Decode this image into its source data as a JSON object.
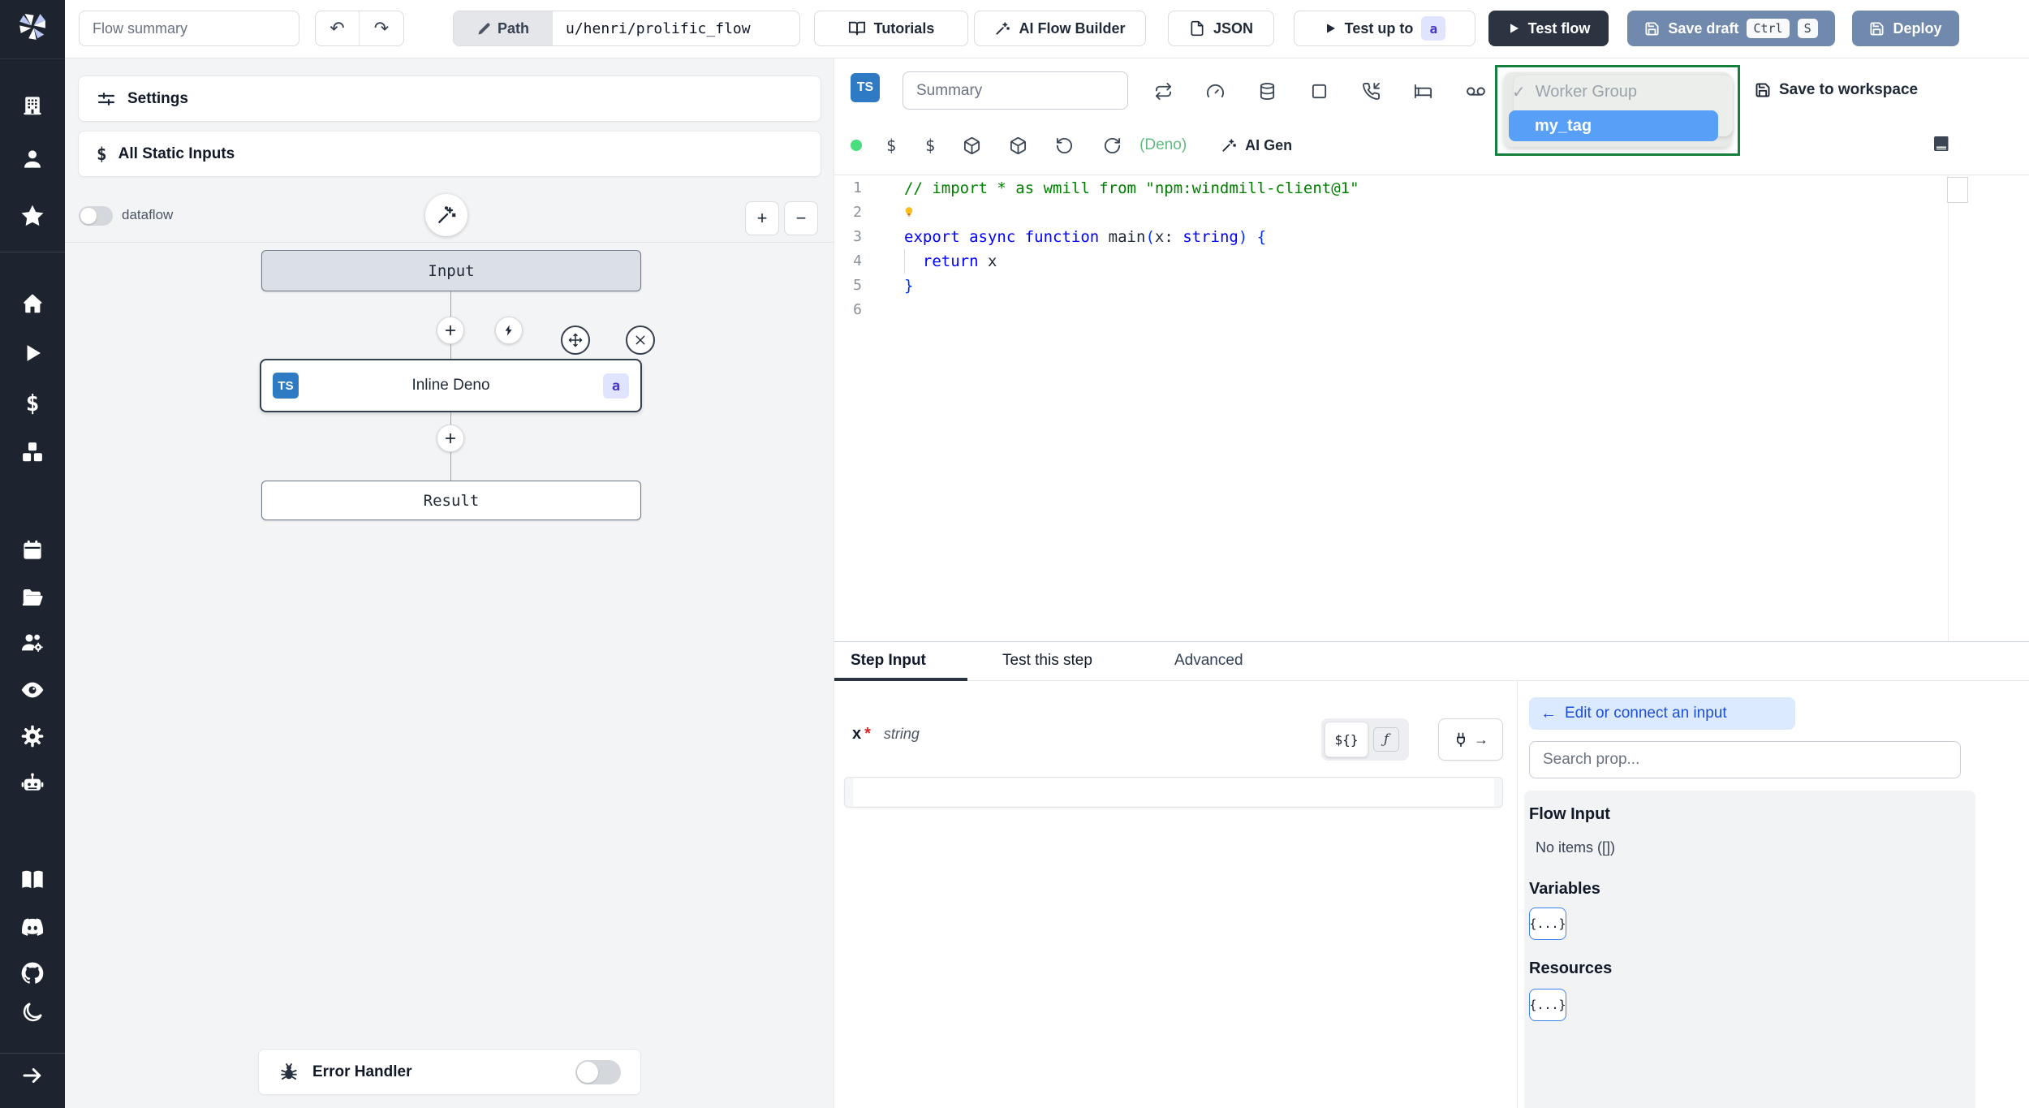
{
  "colors": {
    "sidebar_bg": "#1e242f",
    "action_blue": "#7089ac",
    "dark_button": "#2b3440",
    "tag_blue": "#579ff7",
    "dropdown_green": "#15803d",
    "ts_badge_blue": "#2f7bc3",
    "badge_indigo_bg": "#e0e4ff",
    "badge_indigo_text": "#4338ca",
    "status_green": "#4ade80"
  },
  "sidebar": {
    "icons": [
      "windmill-logo",
      "workspace-building",
      "user",
      "favorites-star",
      "home",
      "runs-play",
      "variables-dollar",
      "resources-cubes",
      "schedules-calendar",
      "folders",
      "groups",
      "audit-eye",
      "settings-gear",
      "workers-robot",
      "docs-book",
      "discord",
      "github",
      "dark-mode-moon",
      "expand-arrow"
    ]
  },
  "topbar": {
    "flow_summary_placeholder": "Flow summary",
    "path_label": "Path",
    "path_value": "u/henri/prolific_flow",
    "tutorials": "Tutorials",
    "ai_flow_builder": "AI Flow Builder",
    "json": "JSON",
    "test_up_to": "Test up to",
    "test_up_to_badge": "a",
    "test_flow": "Test flow",
    "save_draft": "Save draft",
    "kbd_ctrl": "Ctrl",
    "kbd_s": "S",
    "deploy": "Deploy"
  },
  "flow_panel": {
    "settings": "Settings",
    "all_static_inputs": "All Static Inputs",
    "dataflow_label": "dataflow",
    "zoom_in": "+",
    "zoom_out": "−",
    "nodes": {
      "input": "Input",
      "step_lang": "TS",
      "step_label": "Inline Deno",
      "step_badge": "a",
      "result": "Result"
    },
    "error_handler": "Error Handler"
  },
  "editor": {
    "lang_badge": "TS",
    "summary_placeholder": "Summary",
    "runtime": "(Deno)",
    "ai_gen": "AI Gen",
    "code": {
      "lines": [
        {
          "n": "1",
          "tokens": [
            {
              "t": "// import * as wmill from \"npm:windmill-client@1\"",
              "c": "comment"
            }
          ]
        },
        {
          "n": "2",
          "tokens": []
        },
        {
          "n": "3",
          "tokens": [
            {
              "t": "export ",
              "c": "kw"
            },
            {
              "t": "async ",
              "c": "kw"
            },
            {
              "t": "function ",
              "c": "kw"
            },
            {
              "t": "main",
              "c": "id"
            },
            {
              "t": "(",
              "c": "br"
            },
            {
              "t": "x",
              "c": "id"
            },
            {
              "t": ": ",
              "c": "pl"
            },
            {
              "t": "string",
              "c": "kw"
            },
            {
              "t": ")",
              "c": "br"
            },
            {
              "t": " ",
              "c": "pl"
            },
            {
              "t": "{",
              "c": "br"
            }
          ]
        },
        {
          "n": "4",
          "tokens": [
            {
              "t": "  return ",
              "c": "kw"
            },
            {
              "t": "x",
              "c": "id"
            }
          ]
        },
        {
          "n": "5",
          "tokens": [
            {
              "t": "}",
              "c": "br"
            }
          ]
        },
        {
          "n": "6",
          "tokens": []
        }
      ]
    }
  },
  "dropdown": {
    "check": "✓",
    "group_label": "Worker Group",
    "selected_tag": "my_tag"
  },
  "workspace": {
    "save_to_workspace": "Save to workspace"
  },
  "step_panel": {
    "tabs": [
      "Step Input",
      "Test this step",
      "Advanced"
    ],
    "arg_name": "x",
    "required_mark": "*",
    "arg_type": "string",
    "toggle_expr": "${}",
    "toggle_fn": "ƒ",
    "plug_arrow": "→",
    "input_value": ""
  },
  "prop_picker": {
    "back_arrow": "←",
    "edit_or_connect": "Edit or connect an input",
    "search_placeholder": "Search prop...",
    "sections": [
      {
        "title": "Flow Input",
        "empty": "No items ([])"
      },
      {
        "title": "Variables",
        "badge": "{...}"
      },
      {
        "title": "Resources",
        "badge": "{...}"
      }
    ]
  }
}
